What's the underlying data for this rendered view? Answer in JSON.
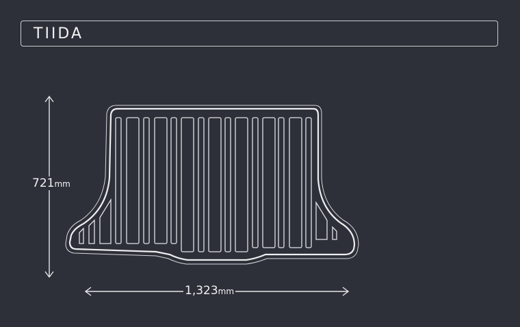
{
  "header": {
    "model": "TIIDA"
  },
  "dimensions": {
    "width_value": "1,323",
    "height_value": "721",
    "unit": "mm"
  },
  "colors": {
    "background": "#2d3038",
    "line": "#e6e7ea"
  }
}
